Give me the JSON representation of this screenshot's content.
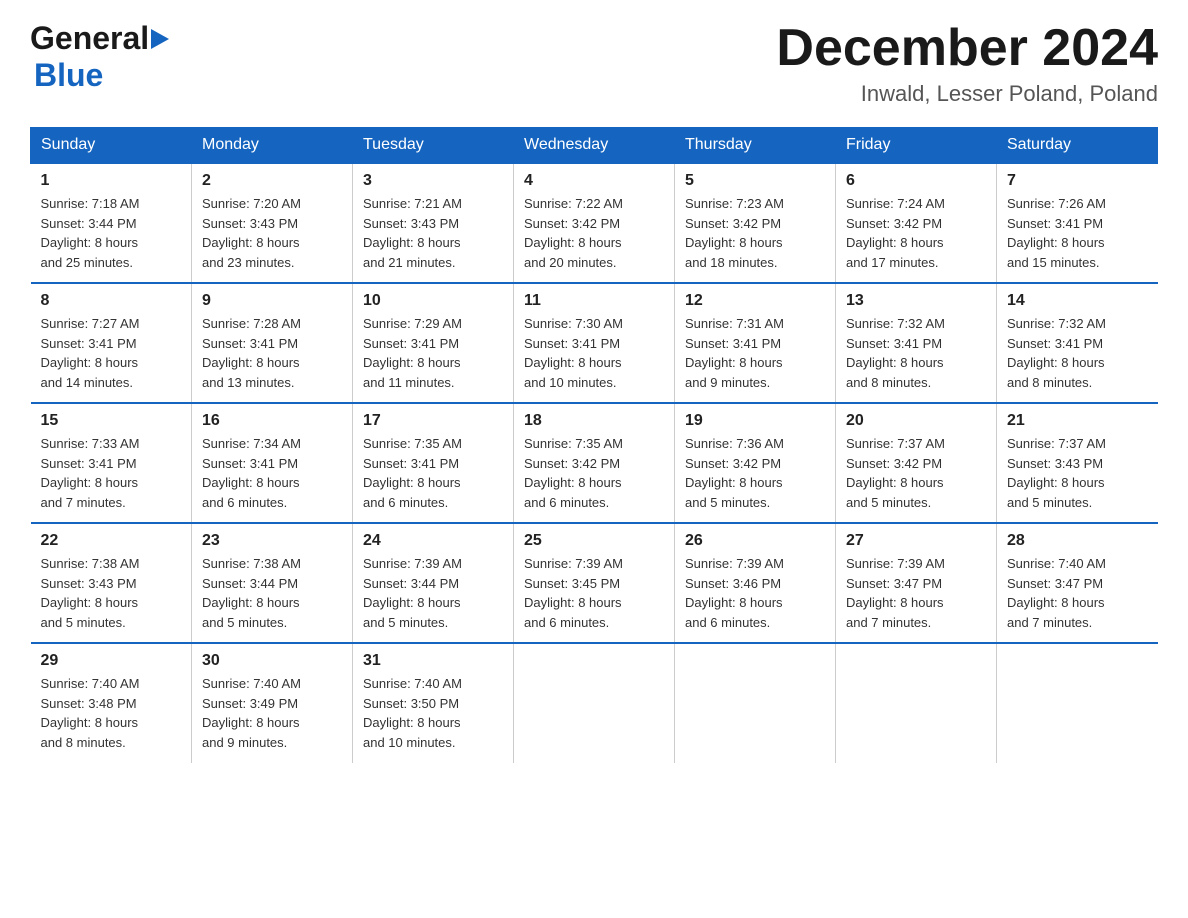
{
  "header": {
    "logo_line1": "General",
    "logo_triangle": "▶",
    "logo_line2": "Blue",
    "month_title": "December 2024",
    "location": "Inwald, Lesser Poland, Poland"
  },
  "weekdays": [
    "Sunday",
    "Monday",
    "Tuesday",
    "Wednesday",
    "Thursday",
    "Friday",
    "Saturday"
  ],
  "weeks": [
    [
      {
        "day": "1",
        "info": "Sunrise: 7:18 AM\nSunset: 3:44 PM\nDaylight: 8 hours\nand 25 minutes."
      },
      {
        "day": "2",
        "info": "Sunrise: 7:20 AM\nSunset: 3:43 PM\nDaylight: 8 hours\nand 23 minutes."
      },
      {
        "day": "3",
        "info": "Sunrise: 7:21 AM\nSunset: 3:43 PM\nDaylight: 8 hours\nand 21 minutes."
      },
      {
        "day": "4",
        "info": "Sunrise: 7:22 AM\nSunset: 3:42 PM\nDaylight: 8 hours\nand 20 minutes."
      },
      {
        "day": "5",
        "info": "Sunrise: 7:23 AM\nSunset: 3:42 PM\nDaylight: 8 hours\nand 18 minutes."
      },
      {
        "day": "6",
        "info": "Sunrise: 7:24 AM\nSunset: 3:42 PM\nDaylight: 8 hours\nand 17 minutes."
      },
      {
        "day": "7",
        "info": "Sunrise: 7:26 AM\nSunset: 3:41 PM\nDaylight: 8 hours\nand 15 minutes."
      }
    ],
    [
      {
        "day": "8",
        "info": "Sunrise: 7:27 AM\nSunset: 3:41 PM\nDaylight: 8 hours\nand 14 minutes."
      },
      {
        "day": "9",
        "info": "Sunrise: 7:28 AM\nSunset: 3:41 PM\nDaylight: 8 hours\nand 13 minutes."
      },
      {
        "day": "10",
        "info": "Sunrise: 7:29 AM\nSunset: 3:41 PM\nDaylight: 8 hours\nand 11 minutes."
      },
      {
        "day": "11",
        "info": "Sunrise: 7:30 AM\nSunset: 3:41 PM\nDaylight: 8 hours\nand 10 minutes."
      },
      {
        "day": "12",
        "info": "Sunrise: 7:31 AM\nSunset: 3:41 PM\nDaylight: 8 hours\nand 9 minutes."
      },
      {
        "day": "13",
        "info": "Sunrise: 7:32 AM\nSunset: 3:41 PM\nDaylight: 8 hours\nand 8 minutes."
      },
      {
        "day": "14",
        "info": "Sunrise: 7:32 AM\nSunset: 3:41 PM\nDaylight: 8 hours\nand 8 minutes."
      }
    ],
    [
      {
        "day": "15",
        "info": "Sunrise: 7:33 AM\nSunset: 3:41 PM\nDaylight: 8 hours\nand 7 minutes."
      },
      {
        "day": "16",
        "info": "Sunrise: 7:34 AM\nSunset: 3:41 PM\nDaylight: 8 hours\nand 6 minutes."
      },
      {
        "day": "17",
        "info": "Sunrise: 7:35 AM\nSunset: 3:41 PM\nDaylight: 8 hours\nand 6 minutes."
      },
      {
        "day": "18",
        "info": "Sunrise: 7:35 AM\nSunset: 3:42 PM\nDaylight: 8 hours\nand 6 minutes."
      },
      {
        "day": "19",
        "info": "Sunrise: 7:36 AM\nSunset: 3:42 PM\nDaylight: 8 hours\nand 5 minutes."
      },
      {
        "day": "20",
        "info": "Sunrise: 7:37 AM\nSunset: 3:42 PM\nDaylight: 8 hours\nand 5 minutes."
      },
      {
        "day": "21",
        "info": "Sunrise: 7:37 AM\nSunset: 3:43 PM\nDaylight: 8 hours\nand 5 minutes."
      }
    ],
    [
      {
        "day": "22",
        "info": "Sunrise: 7:38 AM\nSunset: 3:43 PM\nDaylight: 8 hours\nand 5 minutes."
      },
      {
        "day": "23",
        "info": "Sunrise: 7:38 AM\nSunset: 3:44 PM\nDaylight: 8 hours\nand 5 minutes."
      },
      {
        "day": "24",
        "info": "Sunrise: 7:39 AM\nSunset: 3:44 PM\nDaylight: 8 hours\nand 5 minutes."
      },
      {
        "day": "25",
        "info": "Sunrise: 7:39 AM\nSunset: 3:45 PM\nDaylight: 8 hours\nand 6 minutes."
      },
      {
        "day": "26",
        "info": "Sunrise: 7:39 AM\nSunset: 3:46 PM\nDaylight: 8 hours\nand 6 minutes."
      },
      {
        "day": "27",
        "info": "Sunrise: 7:39 AM\nSunset: 3:47 PM\nDaylight: 8 hours\nand 7 minutes."
      },
      {
        "day": "28",
        "info": "Sunrise: 7:40 AM\nSunset: 3:47 PM\nDaylight: 8 hours\nand 7 minutes."
      }
    ],
    [
      {
        "day": "29",
        "info": "Sunrise: 7:40 AM\nSunset: 3:48 PM\nDaylight: 8 hours\nand 8 minutes."
      },
      {
        "day": "30",
        "info": "Sunrise: 7:40 AM\nSunset: 3:49 PM\nDaylight: 8 hours\nand 9 minutes."
      },
      {
        "day": "31",
        "info": "Sunrise: 7:40 AM\nSunset: 3:50 PM\nDaylight: 8 hours\nand 10 minutes."
      },
      {
        "day": "",
        "info": ""
      },
      {
        "day": "",
        "info": ""
      },
      {
        "day": "",
        "info": ""
      },
      {
        "day": "",
        "info": ""
      }
    ]
  ]
}
